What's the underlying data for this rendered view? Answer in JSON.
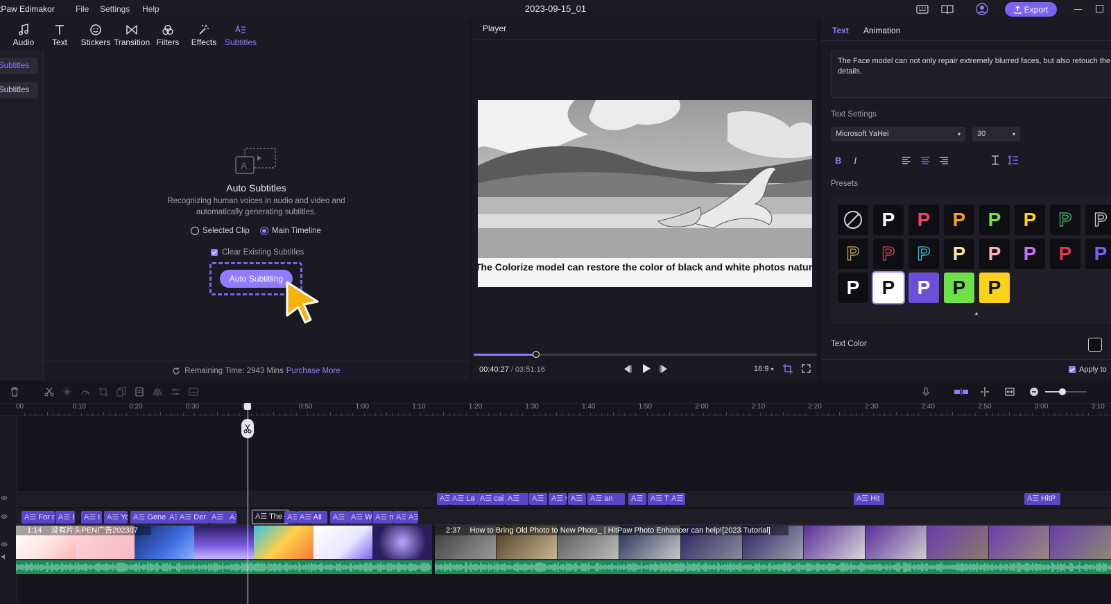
{
  "app": {
    "name": "tPaw Edimakor",
    "menu": [
      "File",
      "Settings",
      "Help"
    ],
    "project_title": "2023-09-15_01",
    "export_label": "Export"
  },
  "toolbar": {
    "items": [
      {
        "label": "Audio",
        "icon": "music-note-icon"
      },
      {
        "label": "Text",
        "icon": "text-t-icon"
      },
      {
        "label": "Stickers",
        "icon": "sticker-face-icon"
      },
      {
        "label": "Transition",
        "icon": "bowtie-transition-icon"
      },
      {
        "label": "Filters",
        "icon": "filter-circles-icon"
      },
      {
        "label": "Effects",
        "icon": "magic-wand-icon"
      },
      {
        "label": "Subtitles",
        "icon": "subtitles-icon",
        "active": true
      }
    ]
  },
  "subnav": {
    "items": [
      {
        "label": "Subtitles",
        "active": true
      },
      {
        "label": "Subtitles",
        "active": false
      }
    ]
  },
  "auto_subtitles": {
    "title": "Auto Subtitles",
    "description_line1": "Recognizing human voices in audio and video and",
    "description_line2": "automatically generating subtitles.",
    "radio_selected_clip": "Selected Clip",
    "radio_main_timeline": "Main Timeline",
    "selected_radio": "Main Timeline",
    "checkbox_label": "Clear Existing Subtitles",
    "checkbox_checked": true,
    "button_label": "Auto Subtitling",
    "remaining_label": "Remaining Time: 2943 Mins",
    "purchase_label": "Purchase More"
  },
  "player": {
    "title": "Player",
    "caption": "The Colorize model can restore the color of black and white photos naturally",
    "current_time": "00:40:27",
    "total_time": "03:51:16",
    "time_separator": "/",
    "aspect_ratio": "16:9",
    "progress": 0.18
  },
  "right_panel": {
    "tabs": [
      {
        "label": "Text",
        "active": true
      },
      {
        "label": "Animation",
        "active": false
      }
    ],
    "text_value": "The Face model can not only repair extremely blurred faces, but also retouch the face details.",
    "text_settings_label": "Text Settings",
    "font_name": "Microsoft YaHei",
    "font_size": "30",
    "presets_label": "Presets",
    "preset_glyph": "P",
    "presets": [
      {
        "style": "none"
      },
      {
        "color": "#ffffff",
        "bg": "#0f0f13"
      },
      {
        "color": "#f0456a",
        "bg": "#0f0f13"
      },
      {
        "color": "#f7a21b",
        "bg": "#0f0f13"
      },
      {
        "color": "#7ee04b",
        "bg": "#0f0f13"
      },
      {
        "color": "#ffd21a",
        "bg": "#0f0f13"
      },
      {
        "color": "#3ec46d",
        "bg": "#0f0f13",
        "outline": true
      },
      {
        "color": "#d0d0d0",
        "bg": "#0f0f13",
        "outline": true
      },
      {
        "color": "#c9a25b",
        "bg": "#0f0f13",
        "outline": true
      },
      {
        "color": "#d0435e",
        "bg": "#0f0f13",
        "outline": true
      },
      {
        "color": "#41b9d6",
        "bg": "#0f0f13",
        "outline": true
      },
      {
        "color": "#f7e6a0",
        "bg": "#0f0f13"
      },
      {
        "color": "#ffb3b3",
        "bg": "#0f0f13"
      },
      {
        "color": "#c773ff",
        "bg": "#0f0f13"
      },
      {
        "color": "#e8334f",
        "bg": "#0f0f13"
      },
      {
        "color": "#7b63f0",
        "bg": "#0f0f13"
      },
      {
        "color": "#ffffff",
        "bg": "#0f0f13"
      },
      {
        "color": "#111111",
        "bg": "#ffffff",
        "selected": true
      },
      {
        "color": "#ffffff",
        "bg": "#6b4fd8"
      },
      {
        "color": "#111111",
        "bg": "#6fe04a"
      },
      {
        "color": "#111111",
        "bg": "#ffd21a"
      }
    ],
    "text_color_label": "Text Color",
    "apply_label": "Apply to"
  },
  "timeline": {
    "ticks": [
      "00",
      "0:10",
      "0:20",
      "0:30",
      "0:",
      "0:50",
      "1:00",
      "1:10",
      "1:20",
      "1:30",
      "1:40",
      "1:50",
      "2:00",
      "2:10",
      "2:20",
      "2:30",
      "2:40",
      "2:50",
      "3:00",
      "3:10"
    ],
    "subtitle_track_a": [
      "For r",
      "I",
      "I",
      "Yo",
      "Gene",
      "A",
      "Der",
      "",
      "T",
      "The",
      "",
      "All",
      "",
      "W",
      "m",
      "A",
      ""
    ],
    "subtitle_track_b": [
      "A",
      "La",
      "cai",
      "",
      "",
      "v",
      "",
      "an",
      "",
      "T",
      "S"
    ],
    "subtitle_extra_1": "Hit",
    "subtitle_extra_2": "HitP",
    "clip1_duration": "1:14",
    "clip1_name": "没有片头PEN广告202307",
    "clip2_duration": "2:37",
    "clip2_name": "How to Bring Old Photo to New Photo_ | HitPaw Photo Enhancer can help![2023 Tutorial]"
  }
}
